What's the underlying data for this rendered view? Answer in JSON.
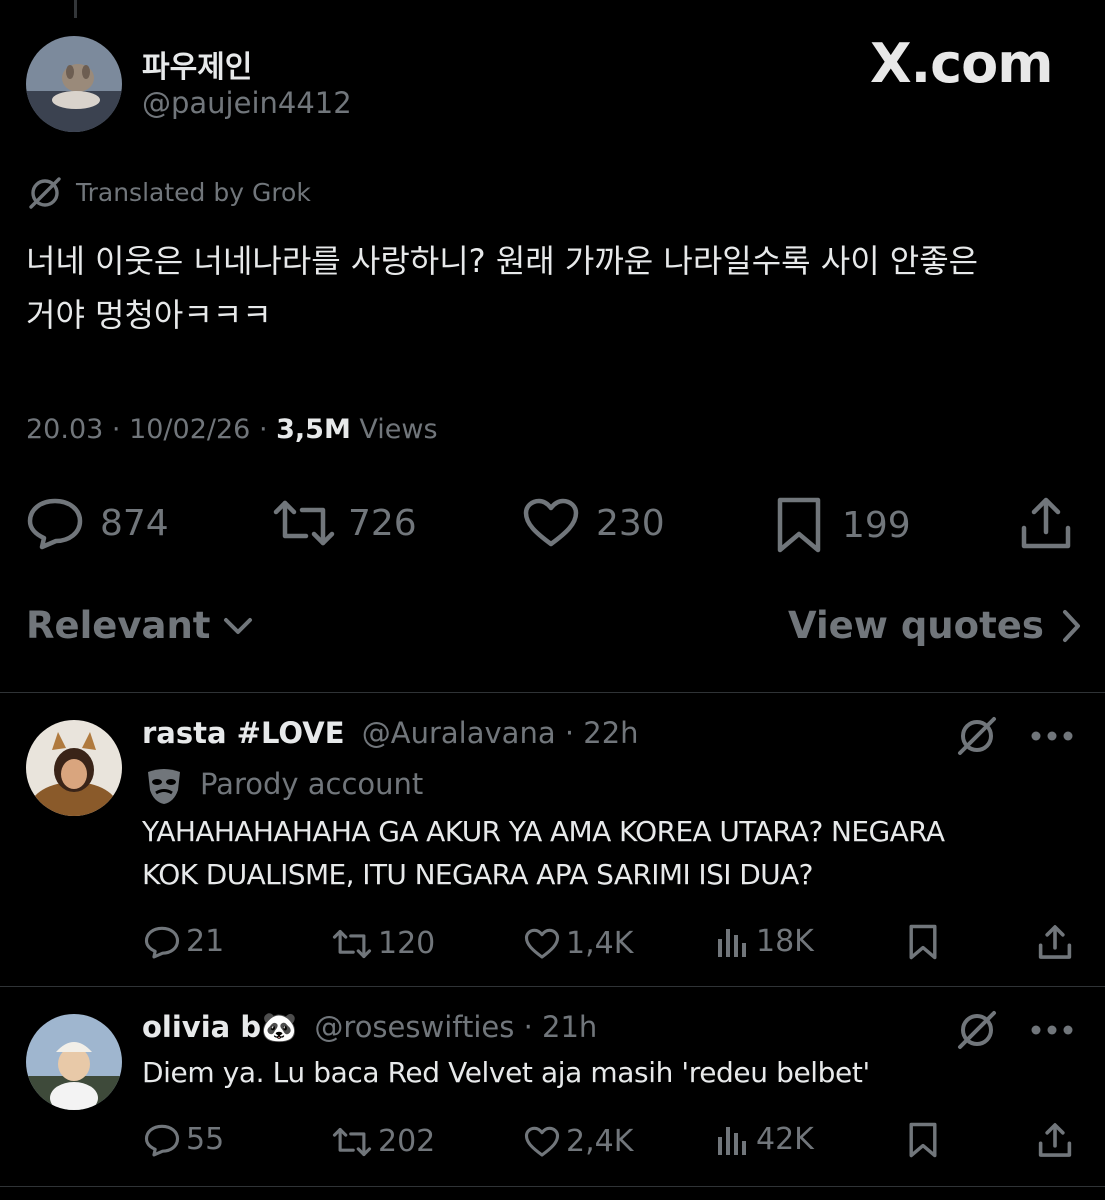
{
  "post": {
    "author_name": "파우제인",
    "author_handle": "@paujein4412",
    "site_watermark": "X.com",
    "translated_label": "Translated by Grok",
    "text_line1": "너네 이웃은 너네나라를 사랑하니? 원래 가까운 나라일수록 사이 안좋은",
    "text_line2": "거야 멍청아ㅋㅋㅋ",
    "time": "20.03",
    "sep1": "·",
    "date": "10/02/26",
    "sep2": "·",
    "views_count": "3,5M",
    "views_label": "Views",
    "replies": "874",
    "reposts": "726",
    "likes": "230",
    "bookmarks": "199"
  },
  "sort": {
    "relevant_label": "Relevant",
    "view_quotes_label": "View quotes"
  },
  "replies": [
    {
      "name": "rasta #LOVE",
      "handle": "@Auralavana",
      "sep": "·",
      "age": "22h",
      "badge": "Parody account",
      "text_line1": "YAHAHAHAHAHA GA AKUR YA AMA KOREA UTARA? NEGARA",
      "text_line2": "KOK DUALISME, ITU NEGARA APA SARIMI ISI DUA?",
      "replies": "21",
      "reposts": "120",
      "likes": "1,4K",
      "views": "18K"
    },
    {
      "name": "olivia b🐼",
      "handle": "@roseswifties",
      "sep": "·",
      "age": "21h",
      "text_line1": "Diem ya. Lu baca Red Velvet aja masih 'redeu belbet'",
      "replies": "55",
      "reposts": "202",
      "likes": "2,4K",
      "views": "42K"
    }
  ],
  "colors": {
    "background": "#000000",
    "primary_text": "#e7e9ea",
    "secondary_text": "#71767b",
    "divider": "#2f3336"
  }
}
